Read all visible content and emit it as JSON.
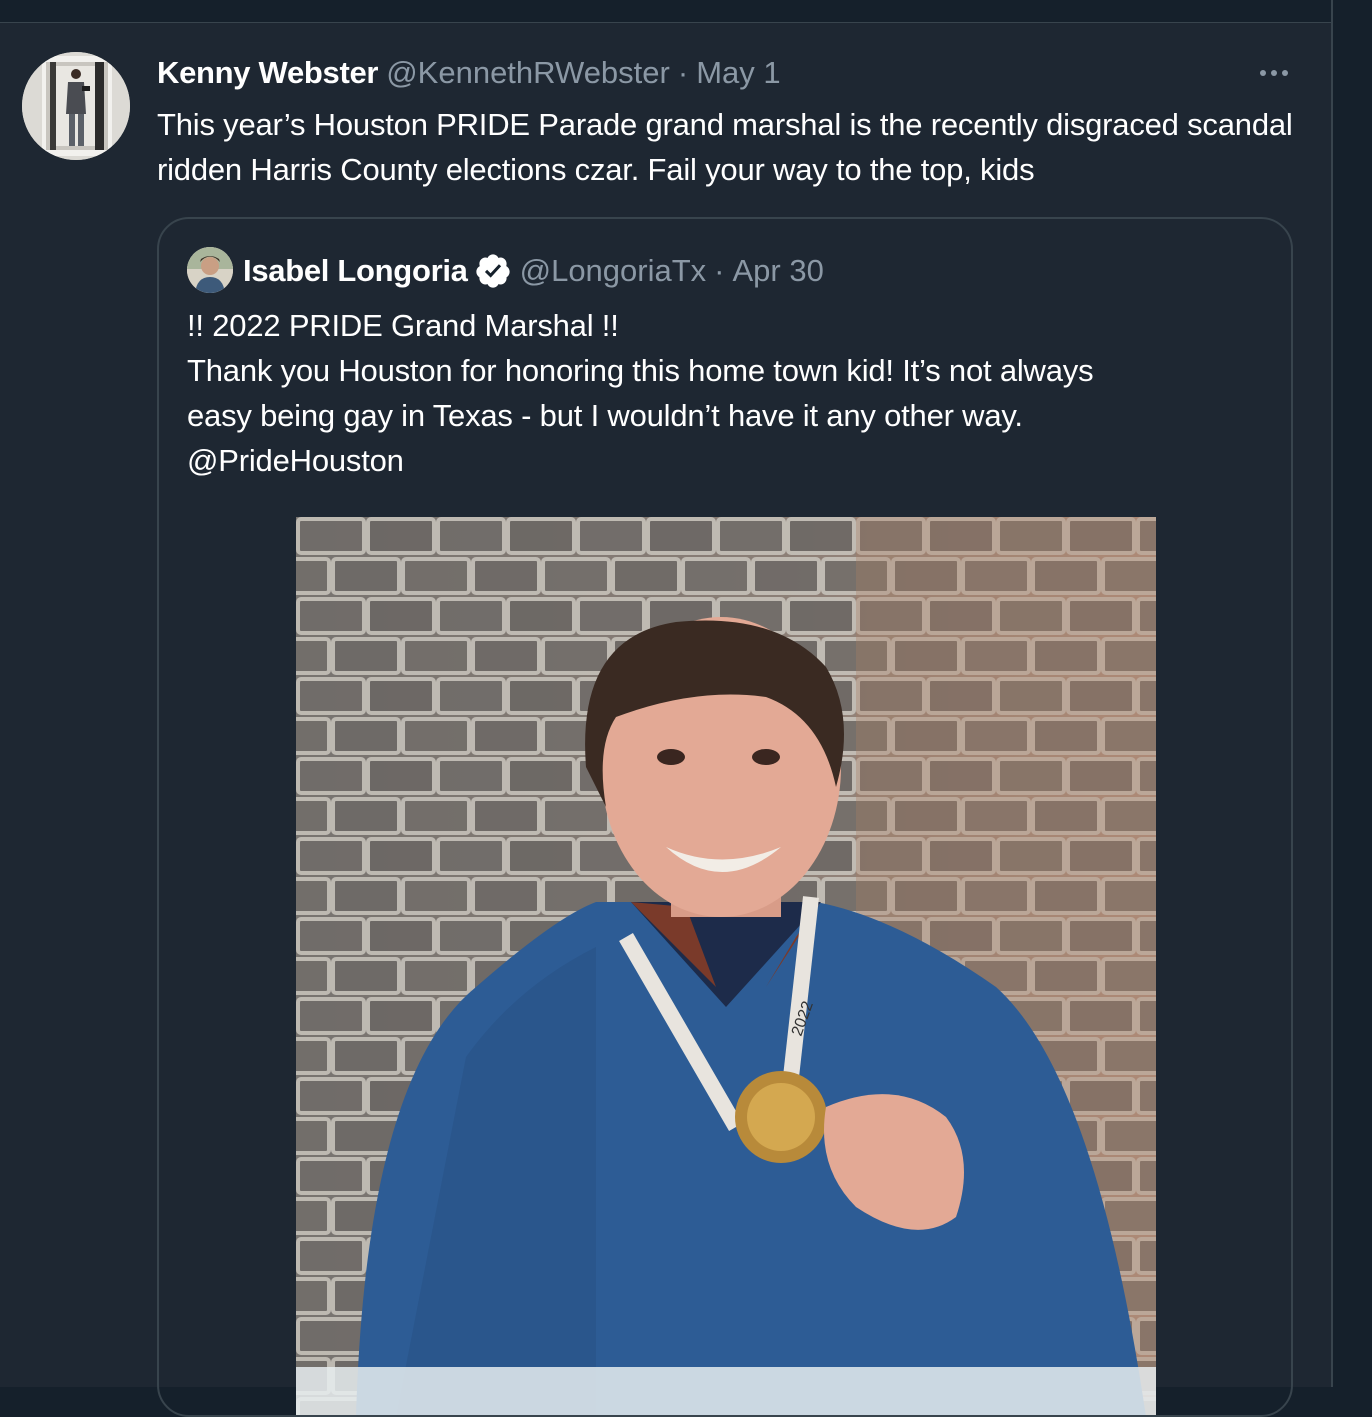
{
  "tweet": {
    "author_name": "Kenny Webster",
    "author_handle": "@KennethRWebster",
    "separator": "·",
    "date": "May 1",
    "text": "This year’s Houston PRIDE Parade grand marshal is the recently disgraced scandal ridden Harris County elections czar. Fail your way to the top, kids",
    "more_icon": "more-horizontal-icon"
  },
  "quoted_tweet": {
    "author_name": "Isabel Longoria",
    "verified_icon": "verified-badge-icon",
    "author_handle": "@LongoriaTx",
    "separator": "·",
    "date": "Apr 30",
    "lines": [
      "!! 2022 PRIDE Grand Marshal !!",
      "Thank you Houston for honoring this home town kid! It’s not always",
      "easy being gay in Texas - but I wouldn’t have it any other way.",
      "@PrideHouston"
    ],
    "photo_medal_text": "2022"
  },
  "colors": {
    "background": "#15202b",
    "tweet_background": "#1e2732",
    "border": "#38444d",
    "secondary_text": "#8b98a5",
    "primary_text": "#ffffff"
  }
}
